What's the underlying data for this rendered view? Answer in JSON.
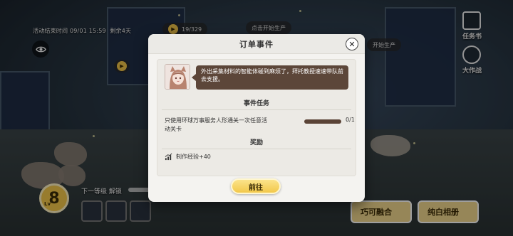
{
  "hud": {
    "event_end": "活动结束时间 09/01 15:59",
    "remaining": "剩余4天",
    "pill_1_value": "19/329",
    "pill_2_text": "点击开始生产",
    "pill_3_text": "开始生产"
  },
  "side_buttons": [
    {
      "label": "任务书",
      "icon": "book-icon"
    },
    {
      "label": "大作战",
      "icon": "crossed-swords-icon"
    }
  ],
  "level": {
    "prefix": "Lv",
    "value": "8",
    "next_unlock": "下一等级 解锁"
  },
  "bottom_buttons": [
    {
      "label": "巧可融合"
    },
    {
      "label": "纯白相册"
    }
  ],
  "dialog": {
    "title": "订单事件",
    "close_label": "✕",
    "message": "外出采集材料的智能体碰到麻烦了，拜托教授速速带队前去支援。",
    "task_section_title": "事件任务",
    "task_text": "只使用环球万事服务人形通关一次任意活动关卡",
    "task_progress_text": "0/1",
    "task_progress_fraction": 0,
    "reward_section_title": "奖励",
    "reward_text": "制作经验+40",
    "reward_icon": "rising-chart-icon",
    "go_label": "前往"
  },
  "colors": {
    "accent": "#f2c84b",
    "bubble": "#5c4639",
    "panel": "#f4f3f0"
  }
}
